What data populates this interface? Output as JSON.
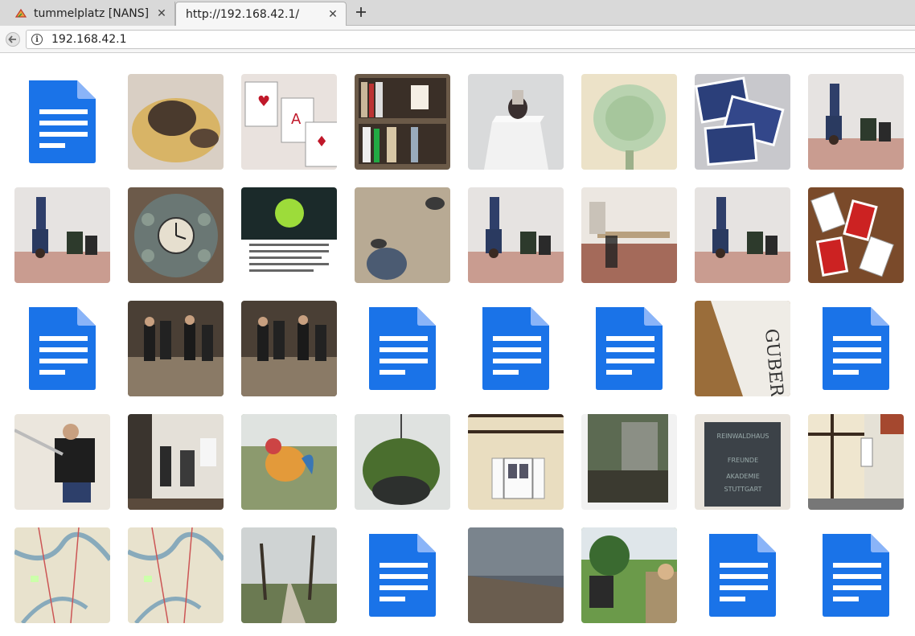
{
  "tabs": [
    {
      "title": "tummelplatz [NANS]",
      "favicon": "tummelplatz-favicon",
      "active": false
    },
    {
      "title": "http://192.168.42.1/",
      "favicon": "none",
      "active": true
    }
  ],
  "address_bar": {
    "url": "192.168.42.1",
    "info_icon": "info-icon"
  },
  "colors": {
    "doc_blue": "#1a73e8",
    "doc_fold": "#8ab4f8",
    "tabbar": "#d9d9d9"
  },
  "gallery": {
    "rows": [
      [
        "doc",
        "photo-truffle-potato",
        "photo-playing-cards",
        "photo-bookshelf",
        "photo-hand-sculpture-pedestal",
        "photo-cabbage-drawing",
        "photo-card-backs-blue",
        "photo-headstand-room"
      ],
      [
        "photo-headstand-room",
        "photo-astronomical-clock",
        "photo-poster",
        "photo-feet-gravel",
        "photo-headstand-room",
        "photo-table-chairs-room",
        "photo-headstand-room",
        "photo-cards-wooden-table"
      ],
      [
        "doc",
        "photo-group-dark-room",
        "photo-group-dark-room",
        "doc",
        "doc",
        "doc",
        "photo-book-gubernator",
        "doc"
      ],
      [
        "photo-person-wall",
        "photo-people-hallway",
        "photo-rooster-figure",
        "photo-hanging-planter",
        "photo-half-timbered-window",
        "photo-window-reflection",
        "photo-reinwaldhaus-plaque",
        "photo-half-timbered-house"
      ],
      [
        "photo-map",
        "photo-map",
        "photo-path-trees",
        "doc",
        "photo-lake-shore",
        "photo-people-park",
        "doc",
        "doc"
      ]
    ]
  }
}
